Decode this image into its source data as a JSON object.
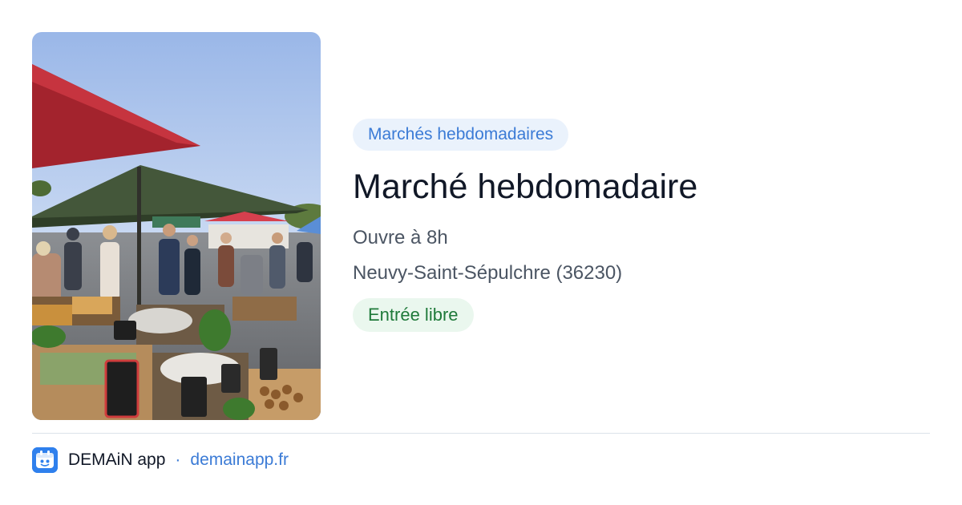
{
  "photo": {
    "alt_icon": "market-photo"
  },
  "event": {
    "category": "Marchés hebdomadaires",
    "title": "Marché hebdomadaire",
    "hours": "Ouvre à 8h",
    "location": "Neuvy-Saint-Sépulchre (36230)",
    "entry": "Entrée libre"
  },
  "footer": {
    "app_name": "DEMAiN app",
    "separator": "·",
    "link": "demainapp.fr"
  },
  "colors": {
    "accent_blue": "#3b7bd6",
    "chip_blue_bg": "#eaf2fc",
    "chip_green_bg": "#eaf7ee",
    "green_text": "#1f7a3a",
    "title_text": "#111827",
    "secondary_text": "#4b5563",
    "divider": "#dbe3ea"
  }
}
